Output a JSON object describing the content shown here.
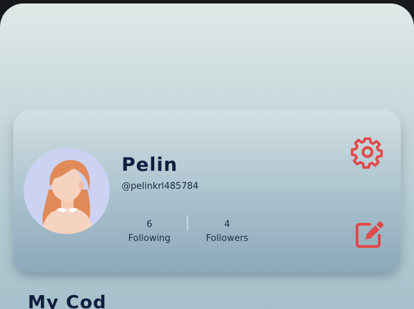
{
  "profile": {
    "name": "Pelin",
    "handle": "@pelinkrl485784",
    "avatar_icon": "woman-avatar-icon",
    "following": {
      "count": "6",
      "label": "Following"
    },
    "followers": {
      "count": "4",
      "label": "Followers"
    }
  },
  "actions": {
    "settings_icon": "gear-icon",
    "edit_icon": "edit-icon"
  },
  "section": {
    "title": "My Cod"
  },
  "colors": {
    "accent": "#e04a4a",
    "name_text": "#0f1d3e",
    "avatar_bg": "#cbd2f2"
  }
}
